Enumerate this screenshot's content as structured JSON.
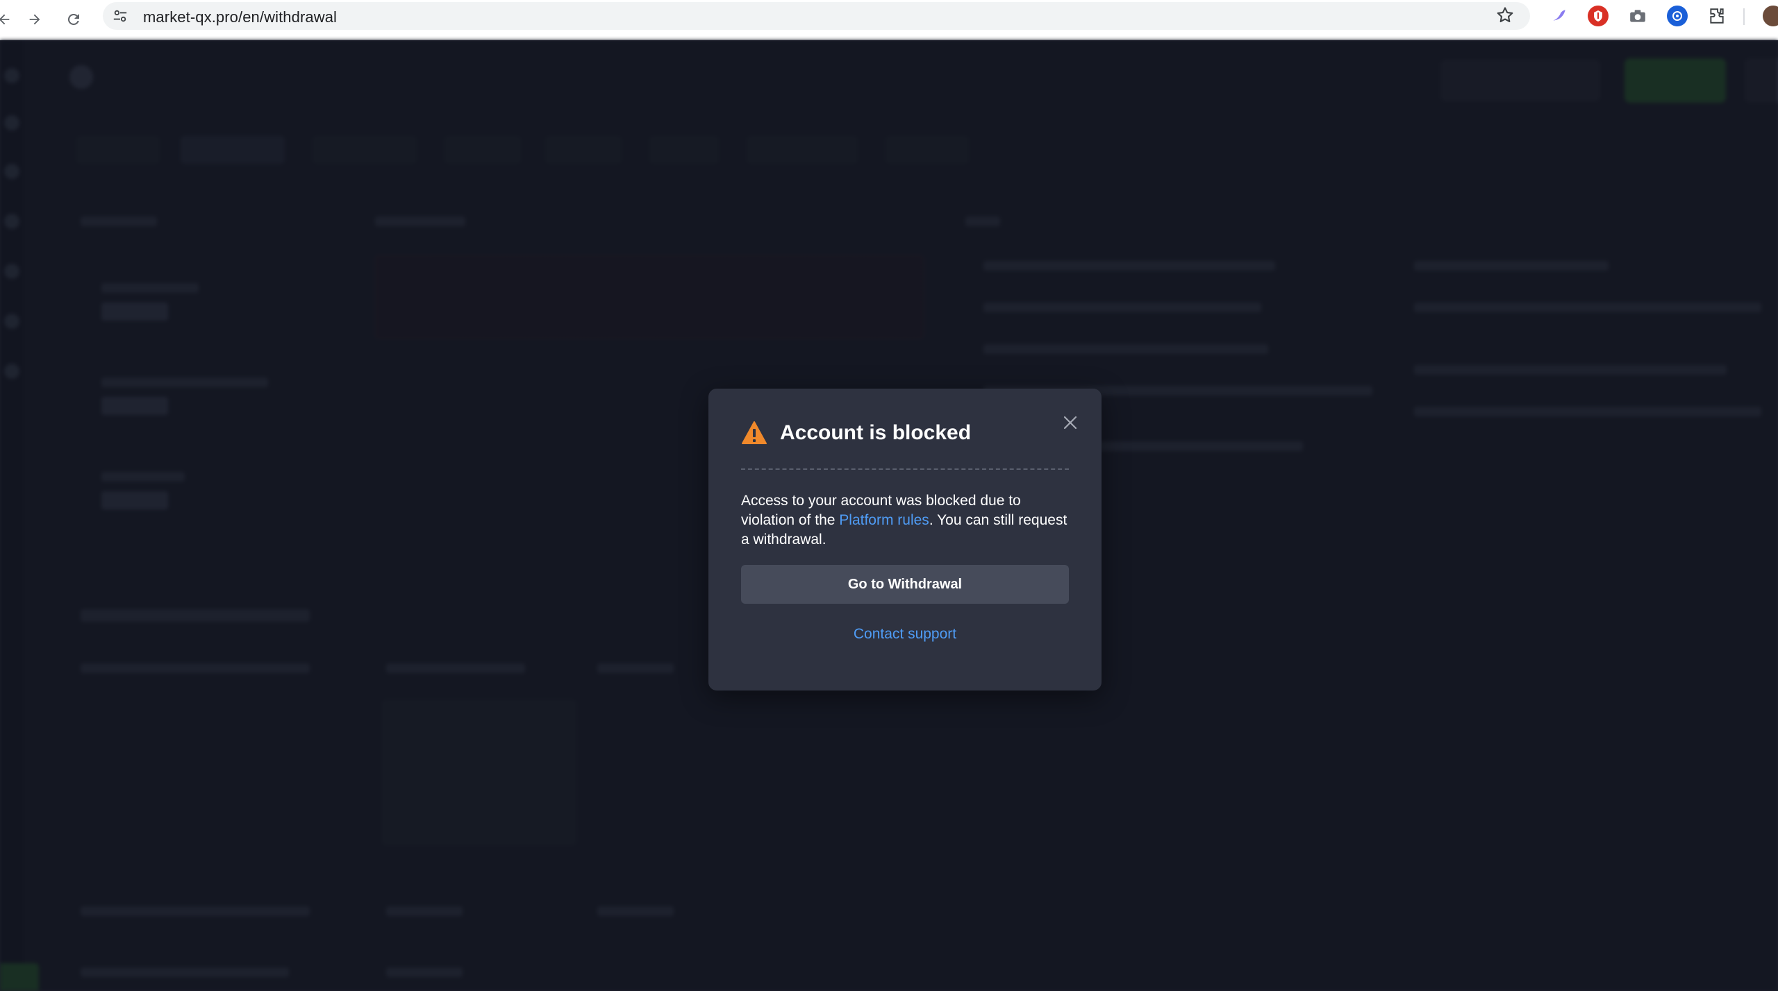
{
  "browser": {
    "url": "market-qx.pro/en/withdrawal",
    "back_icon": "arrow-left-icon",
    "forward_icon": "arrow-right-icon",
    "reload_icon": "reload-icon",
    "bookmark_icon": "star-icon"
  },
  "extensions": [
    {
      "name": "feather-extension-icon",
      "color": "#7b6cf0"
    },
    {
      "name": "shield-extension-icon",
      "color": "#d93025"
    },
    {
      "name": "camera-extension-icon",
      "color": "#5f6368"
    },
    {
      "name": "blue-extension-icon",
      "color": "#1a73e8"
    },
    {
      "name": "puzzle-extension-icon",
      "color": "#3c4043"
    }
  ],
  "modal": {
    "title": "Account is blocked",
    "text_before_link": "Access to your account was blocked due to violation of the ",
    "link_label": "Platform rules",
    "text_after_link": ". You can still request a withdrawal.",
    "primary_button": "Go to Withdrawal",
    "support_link": "Contact support",
    "accent_color": "#4f9cf5",
    "warning_color": "#f0892b"
  }
}
